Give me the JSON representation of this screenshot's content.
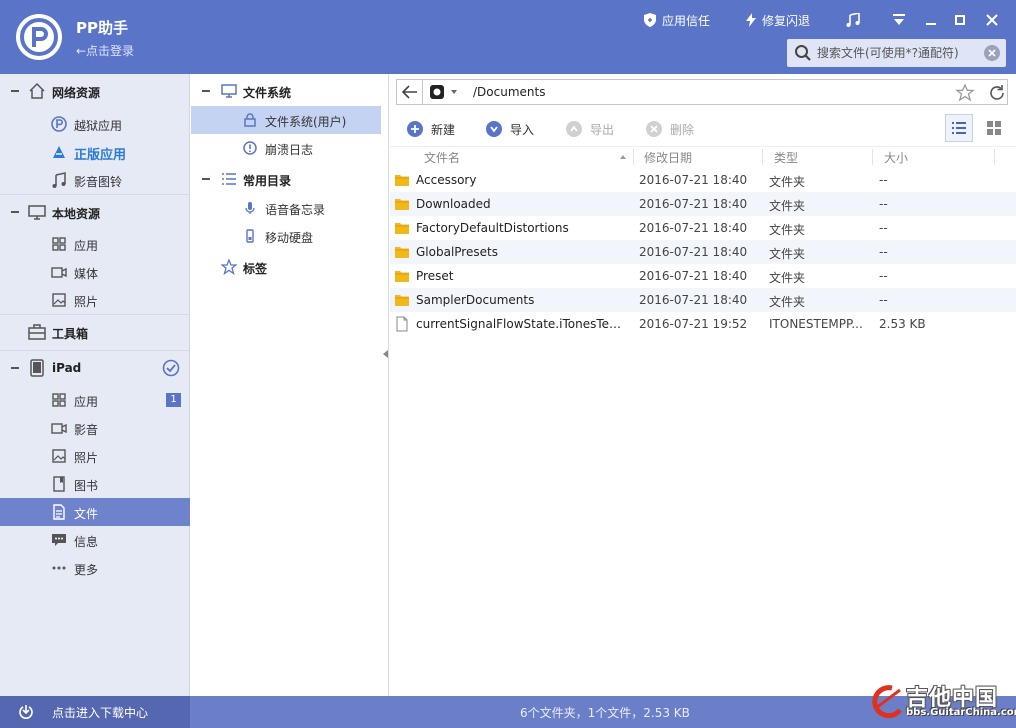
{
  "header": {
    "app_title": "PP助手",
    "login": "←点击登录",
    "trust_label": "应用信任",
    "repair_label": "修复闪退",
    "search_placeholder": "搜索文件(可使用*?通配符)"
  },
  "sidebar": {
    "groups": [
      {
        "label": "网络资源",
        "icon": "home-icon"
      },
      {
        "label": "本地资源",
        "icon": "monitor-icon"
      },
      {
        "label": "工具箱",
        "icon": "toolbox-icon"
      },
      {
        "label": "iPad",
        "icon": "tablet-icon"
      }
    ],
    "net_items": [
      "越狱应用",
      "正版应用",
      "影音图铃"
    ],
    "local_items": [
      "应用",
      "媒体",
      "照片"
    ],
    "ipad_items": [
      "应用",
      "影音",
      "照片",
      "图书",
      "文件",
      "信息",
      "更多"
    ],
    "ipad_app_badge": "1"
  },
  "tree": {
    "fs_group": "文件系统",
    "fs_items": [
      "文件系统(用户)",
      "崩溃日志"
    ],
    "common_group": "常用目录",
    "common_items": [
      "语音备忘录",
      "移动硬盘"
    ],
    "bookmarks": "标签"
  },
  "main": {
    "path": "/Documents",
    "toolbar": {
      "new": "新建",
      "import": "导入",
      "export": "导出",
      "delete": "删除"
    },
    "columns": {
      "name": "文件名",
      "date": "修改日期",
      "type": "类型",
      "size": "大小"
    },
    "rows": [
      {
        "name": "Accessory",
        "date": "2016-07-21 18:40",
        "type": "文件夹",
        "size": "--",
        "kind": "folder"
      },
      {
        "name": "Downloaded",
        "date": "2016-07-21 18:40",
        "type": "文件夹",
        "size": "--",
        "kind": "folder"
      },
      {
        "name": "FactoryDefaultDistortions",
        "date": "2016-07-21 18:40",
        "type": "文件夹",
        "size": "--",
        "kind": "folder"
      },
      {
        "name": "GlobalPresets",
        "date": "2016-07-21 18:40",
        "type": "文件夹",
        "size": "--",
        "kind": "folder"
      },
      {
        "name": "Preset",
        "date": "2016-07-21 18:40",
        "type": "文件夹",
        "size": "--",
        "kind": "folder"
      },
      {
        "name": "SamplerDocuments",
        "date": "2016-07-21 18:40",
        "type": "文件夹",
        "size": "--",
        "kind": "folder"
      },
      {
        "name": "currentSignalFlowState.iTonesTemp...",
        "date": "2016-07-21 19:52",
        "type": "ITONESTEMPP...",
        "size": "2.53 KB",
        "kind": "file"
      }
    ]
  },
  "footer": {
    "download_center": "点击进入下载中心",
    "status": "6个文件夹，1个文件，2.53 KB"
  },
  "watermark": {
    "title": "吉他中国",
    "url": "bbs.GuitarChina.com"
  },
  "colors": {
    "header": "#5a74c8",
    "sidebar": "#e6eaf5",
    "active": "#6e83cc",
    "folder": "#f2b71a"
  }
}
